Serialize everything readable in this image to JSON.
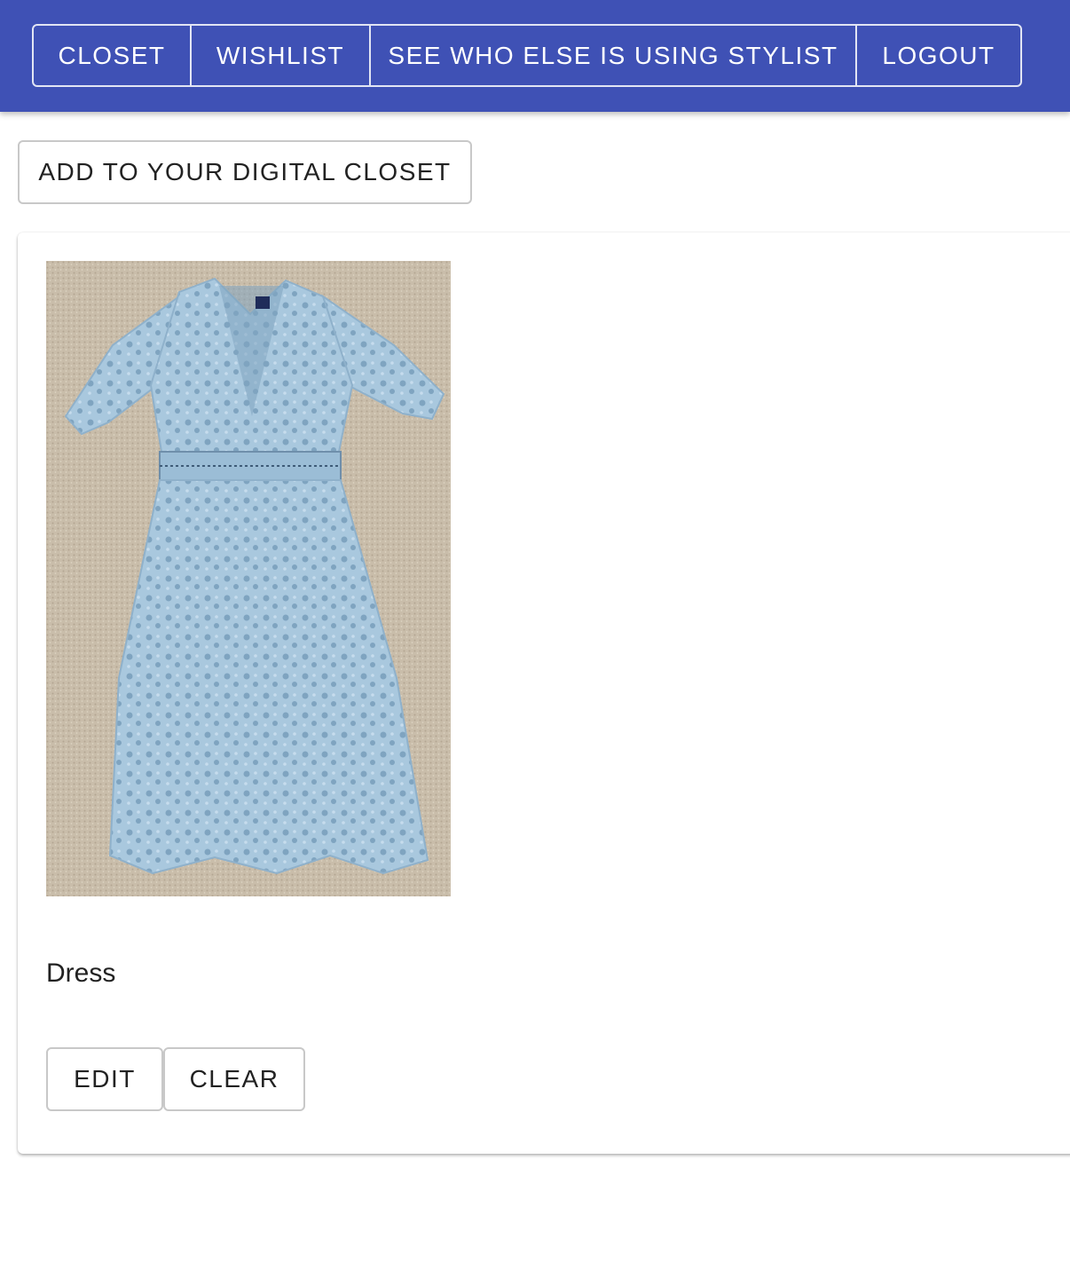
{
  "nav": {
    "items": [
      {
        "label": "CLOSET"
      },
      {
        "label": "WISHLIST"
      },
      {
        "label": "SEE WHO ELSE IS USING STYLIST"
      },
      {
        "label": "LOGOUT"
      }
    ]
  },
  "actions": {
    "add_label": "ADD TO YOUR DIGITAL CLOSET"
  },
  "card": {
    "image_icon": "light-blue-lace-dress-photo",
    "item_name": "Dress",
    "edit_label": "EDIT",
    "clear_label": "CLEAR"
  },
  "colors": {
    "app_bar": "#3f51b5",
    "dress": "#a9c8de",
    "carpet": "#c9bdaa"
  }
}
